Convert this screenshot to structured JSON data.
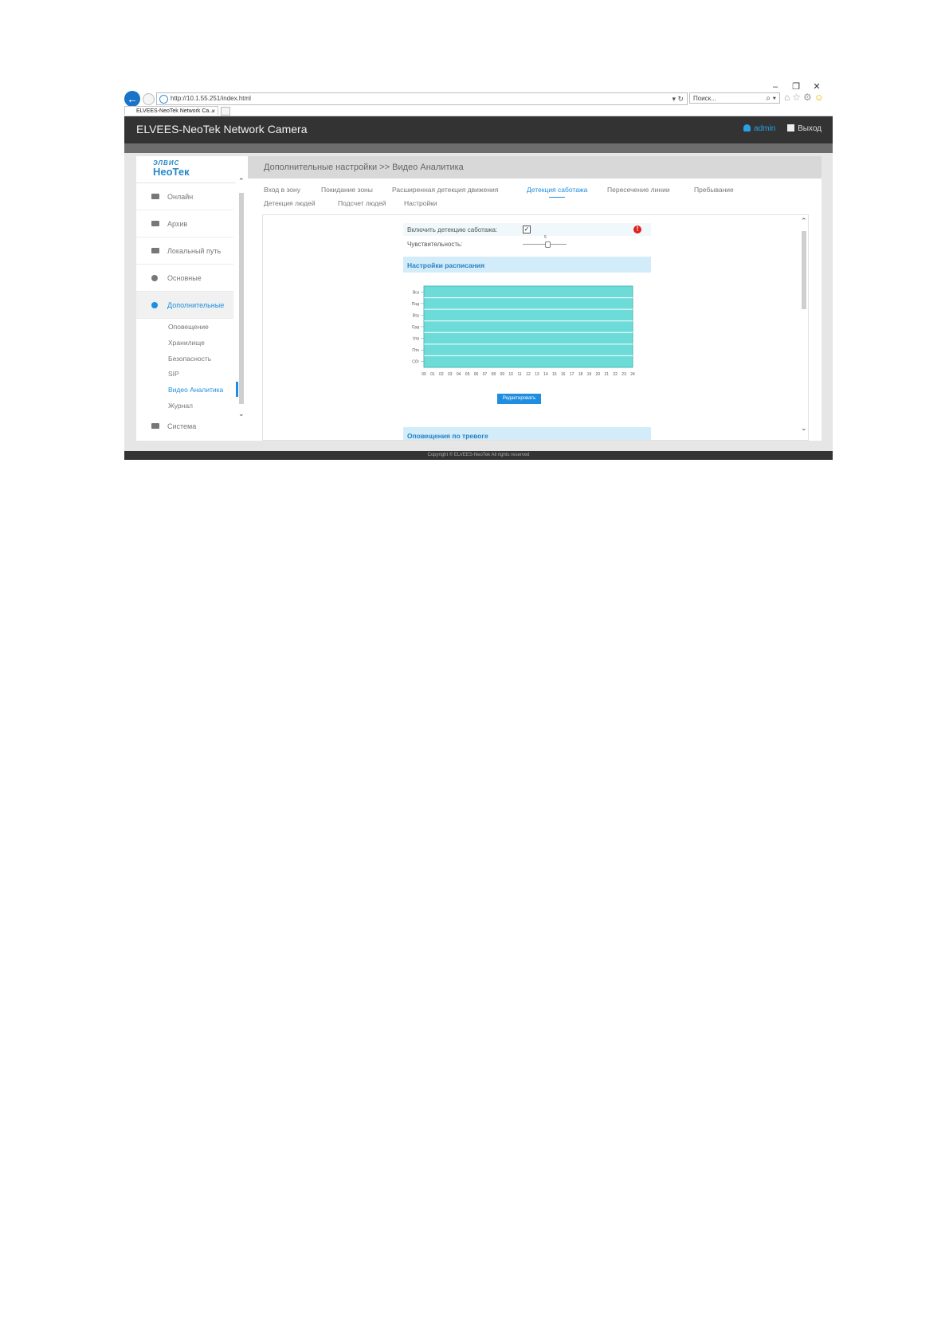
{
  "browser": {
    "url": "http://10.1.55.251/index.html",
    "search_placeholder": "Поиск...",
    "tab_title": "ELVEES-NeoTek Network Ca...",
    "window_controls": [
      "–",
      "❐",
      "✕"
    ]
  },
  "header": {
    "title": "ELVEES-NeoTek Network Camera",
    "user": "admin",
    "logout": "Выход"
  },
  "logo": {
    "line1": "ЭЛВИС",
    "line2": "НеоТек"
  },
  "sidebar": {
    "items": [
      {
        "label": "Онлайн",
        "icon": "video-camera-icon"
      },
      {
        "label": "Архив",
        "icon": "archive-icon"
      },
      {
        "label": "Локальный путь",
        "icon": "folder-icon"
      },
      {
        "label": "Основные",
        "icon": "gear-icon"
      },
      {
        "label": "Дополнительные",
        "icon": "wrench-icon"
      },
      {
        "label": "Система",
        "icon": "monitor-icon"
      }
    ],
    "subitems": [
      "Оповещение",
      "Хранилище",
      "Безопасность",
      "SIP",
      "Видео Аналитика",
      "Журнал"
    ],
    "active_subitem": "Видео Аналитика"
  },
  "breadcrumb": "Дополнительные настройки >> Видео Аналитика",
  "tabs": [
    "Вход в зону",
    "Покидание зоны",
    "Расширенная детекция движения",
    "Детекция саботажа",
    "Пересечение линии",
    "Пребывание",
    "Детекция людей",
    "Подсчет людей",
    "Настройки"
  ],
  "active_tab": "Детекция саботажа",
  "form": {
    "enable_label": "Включить детекцию саботажа:",
    "enable_checked": true,
    "sensitivity_label": "Чувствительность:",
    "sensitivity_value": "5"
  },
  "schedule": {
    "title": "Настройки расписания",
    "days": [
      "Вск",
      "Пнд",
      "Втр",
      "Срд",
      "Чтв",
      "Птн",
      "Сбт"
    ],
    "hours": [
      "00",
      "01",
      "02",
      "03",
      "04",
      "05",
      "06",
      "07",
      "08",
      "09",
      "10",
      "11",
      "12",
      "13",
      "14",
      "15",
      "16",
      "17",
      "18",
      "19",
      "20",
      "21",
      "22",
      "23",
      "24"
    ],
    "fill_color": "#6ddcd9",
    "edit_button": "Редактировать"
  },
  "alarm_section": "Оповещения по тревоге",
  "footer": "Copyright © ELVEES-NeoTek All rights reserved",
  "colors": {
    "accent": "#1f8ee0",
    "header_bg": "#333333",
    "schedule_fill": "#6ddcd9"
  }
}
